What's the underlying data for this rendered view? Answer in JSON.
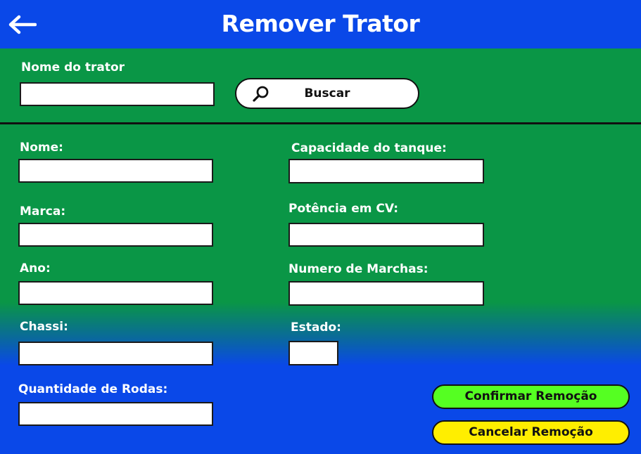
{
  "header": {
    "title": "Remover Trator",
    "back_icon": "arrow-left-icon"
  },
  "search": {
    "label": "Nome do trator",
    "value": "",
    "button_label": "Buscar",
    "button_icon": "search-icon"
  },
  "form": {
    "nome": {
      "label": "Nome:",
      "value": ""
    },
    "marca": {
      "label": "Marca:",
      "value": ""
    },
    "ano": {
      "label": "Ano:",
      "value": ""
    },
    "chassi": {
      "label": "Chassi:",
      "value": ""
    },
    "quantidade_rodas": {
      "label": "Quantidade de Rodas:",
      "value": ""
    },
    "capacidade_tanque": {
      "label": "Capacidade do tanque:",
      "value": ""
    },
    "potencia_cv": {
      "label": "Potência em CV:",
      "value": ""
    },
    "numero_marchas": {
      "label": "Numero de Marchas:",
      "value": ""
    },
    "estado": {
      "label": "Estado:",
      "value": ""
    }
  },
  "actions": {
    "confirm_label": "Confirmar Remoção",
    "cancel_label": "Cancelar Remoção"
  },
  "colors": {
    "header_blue": "#0a48e8",
    "form_green": "#0a9646",
    "confirm_green": "#55ff22",
    "cancel_yellow": "#ffee00"
  }
}
